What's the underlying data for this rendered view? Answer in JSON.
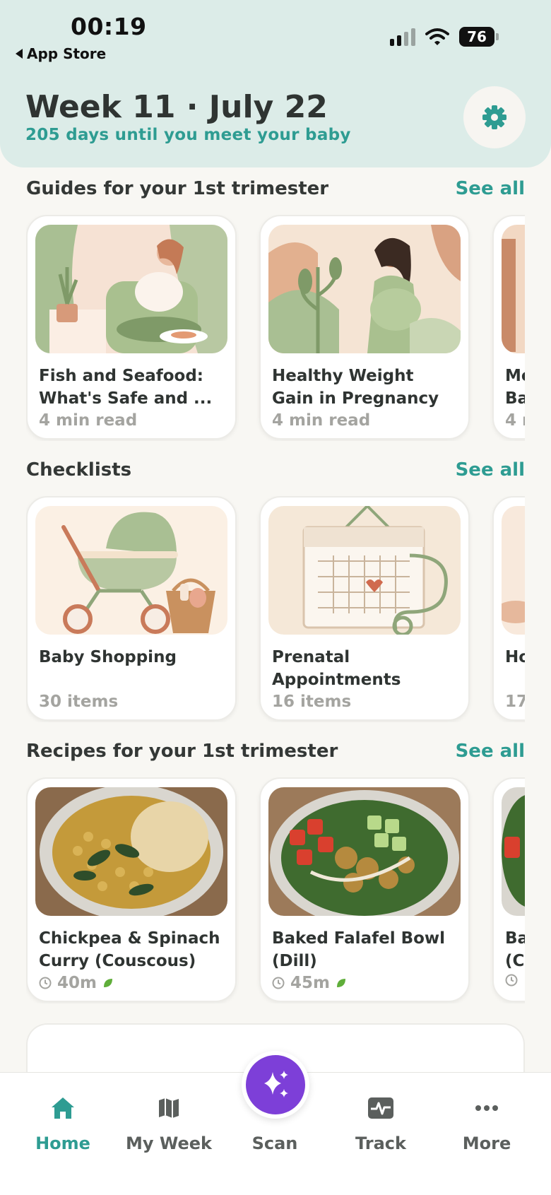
{
  "status_bar": {
    "time": "00:19",
    "back_label": "App Store",
    "battery": "76"
  },
  "header": {
    "title": "Week 11 · July 22",
    "subtitle": "205 days until you meet your baby",
    "settings_icon": "gear-icon"
  },
  "guides": {
    "title": "Guides for your 1st trimester",
    "see_all": "See all",
    "cards": [
      {
        "title": "Fish and Seafood:\nWhat's Safe and ...",
        "meta": "4 min read"
      },
      {
        "title": "Healthy Weight\nGain in Pregnancy",
        "meta": "4 min read"
      },
      {
        "title": "Me\nBa",
        "meta": "4 r"
      }
    ]
  },
  "checklists": {
    "title": "Checklists",
    "see_all": "See all",
    "cards": [
      {
        "title": "Baby Shopping",
        "meta": "30 items"
      },
      {
        "title": "Prenatal\nAppointments",
        "meta": "16 items"
      },
      {
        "title": "Ho",
        "meta": "17"
      }
    ]
  },
  "recipes": {
    "title": "Recipes for your 1st trimester",
    "see_all": "See all",
    "cards": [
      {
        "title": "Chickpea & Spinach\nCurry (Couscous)",
        "time": "40m"
      },
      {
        "title": "Baked Falafel Bowl\n(Dill)",
        "time": "45m"
      },
      {
        "title": "Ba\n(C",
        "time": ""
      }
    ]
  },
  "tabbar": {
    "home": "Home",
    "my_week": "My Week",
    "scan": "Scan",
    "track": "Track",
    "more": "More"
  },
  "colors": {
    "accent": "#2e9c92",
    "header_bg": "#dcece8",
    "scan_purple": "#7d3fd8"
  }
}
